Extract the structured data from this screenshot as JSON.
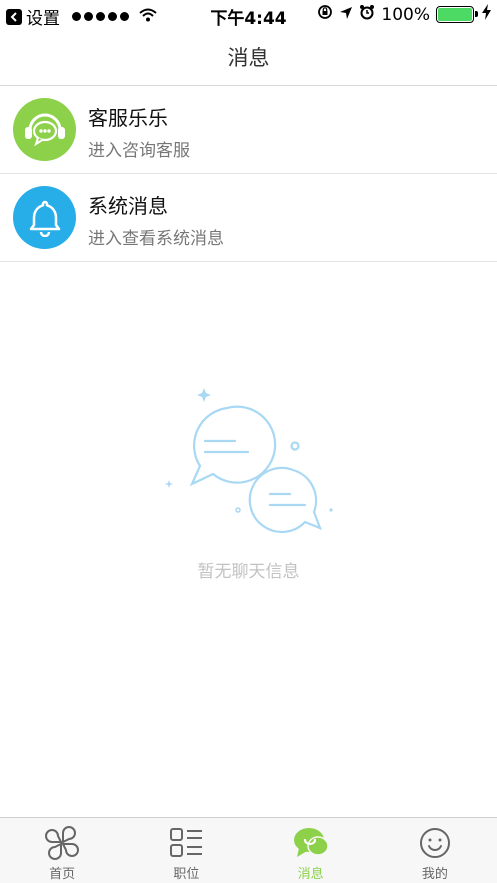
{
  "status_bar": {
    "carrier_back": "设置",
    "time": "下午4:44",
    "battery": "100%"
  },
  "nav": {
    "title": "消息"
  },
  "conversations": [
    {
      "title": "客服乐乐",
      "subtitle": "进入咨询客服",
      "icon": "headset-chat-icon",
      "color": "#8dd14b"
    },
    {
      "title": "系统消息",
      "subtitle": "进入查看系统消息",
      "icon": "bell-icon",
      "color": "#27aee9"
    }
  ],
  "empty_state": {
    "text": "暂无聊天信息",
    "icon": "chat-bubbles-icon"
  },
  "tabs": [
    {
      "label": "首页",
      "icon": "clover-icon",
      "active": false
    },
    {
      "label": "职位",
      "icon": "grid-list-icon",
      "active": false
    },
    {
      "label": "消息",
      "icon": "chat-icon",
      "active": true
    },
    {
      "label": "我的",
      "icon": "smiley-icon",
      "active": false
    }
  ],
  "colors": {
    "accent": "#8dd14b",
    "system_blue": "#27aee9",
    "battery_green": "#4cd964"
  }
}
